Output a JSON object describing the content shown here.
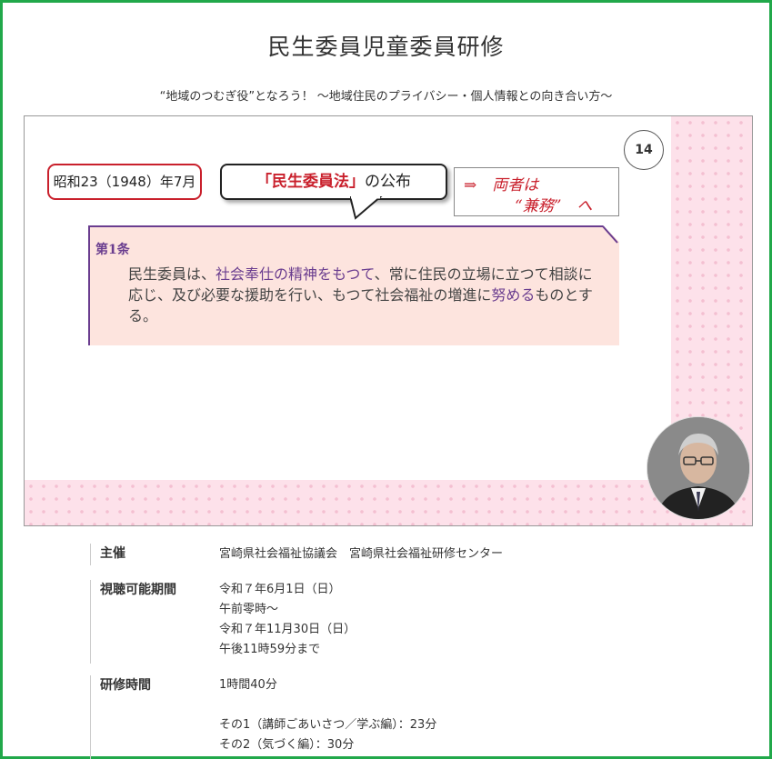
{
  "page": {
    "title": "民生委員児童委員研修",
    "subtitle": "“地域のつむぎ役”となろう！ ～地域住民のプライバシー・個人情報との向き合い方～"
  },
  "slide": {
    "page_number": "14",
    "date_label": "昭和23（1948）年7月",
    "law_quote": "「民生委員法」",
    "law_suffix": "の公布",
    "arrow_line1": "⇒　両者は",
    "arrow_line2": "“兼務”　へ",
    "article_head": "第1条",
    "article_parts": {
      "p1": "民生委員は、",
      "p2": "社会奉仕の精神をもつて",
      "p3": "、常に住民の立場に立つて相談に応じ、及び必要な援助を行い、もつて社会福祉の増進に",
      "p4": "努める",
      "p5": "ものとする。"
    }
  },
  "info": {
    "organizer_label": "主催",
    "organizer_value": "宮崎県社会福祉協議会　宮崎県社会福祉研修センター",
    "period_label": "視聴可能期間",
    "period_lines": [
      "令和７年6月1日（日）",
      "午前零時～",
      "令和７年11月30日（日）",
      "午後11時59分まで"
    ],
    "duration_label": "研修時間",
    "duration_total": "1時間40分",
    "duration_parts": [
      "その1（講師ごあいさつ／学ぶ編）：23分",
      "その2（気づく編）：30分"
    ]
  },
  "colors": {
    "frame": "#21a84a",
    "accent_red": "#c9202c",
    "accent_purple": "#6a3d8f",
    "pink_bg": "#fde1ea"
  },
  "icons": {
    "presenter": "presenter-avatar"
  }
}
